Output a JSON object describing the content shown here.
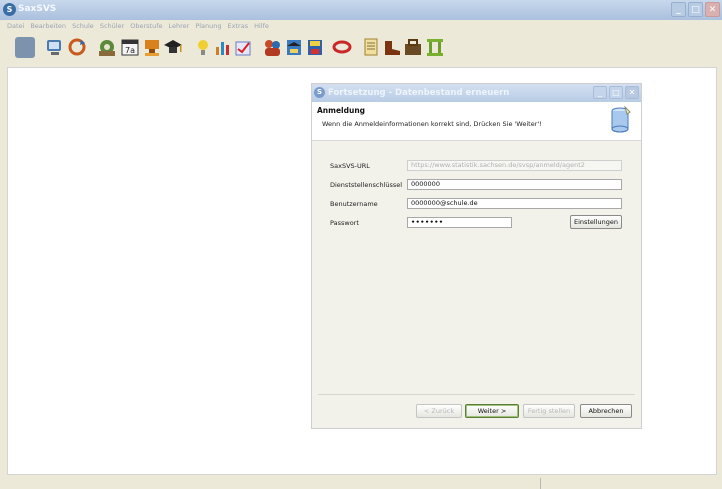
{
  "app": {
    "title": "SaxSVS",
    "icon_letter": "S"
  },
  "window_buttons": {
    "minimize": "_",
    "maximize": "□",
    "close": "✕"
  },
  "menu": [
    "Datei",
    "Bearbeiten",
    "Schule",
    "Schüler",
    "Oberstufe",
    "Lehrer",
    "Planung",
    "Extras",
    "Hilfe"
  ],
  "toolbar": {
    "icons": [
      "blank-icon",
      "computer-icon",
      "refresh-icon",
      "gear-icon",
      "calendar-icon",
      "stamp-icon",
      "graduation-cap-icon",
      "lightbulb-icon",
      "chart-icon",
      "check-chart-icon",
      "students-icon",
      "graduates-icon",
      "disk-icon",
      "ring-icon",
      "notes-icon",
      "boots-icon",
      "briefcase-icon",
      "column-icon"
    ],
    "colors": {
      "blank": "#6f8fb0",
      "computer": "#3f6da0",
      "refresh": "#c85a1e",
      "gear": "#4a7a32",
      "calendar": "#3a3a3a",
      "stamp": "#d0801a",
      "graduation": "#242424",
      "lightbulb": "#e8c020",
      "chart": "#d08020",
      "check": "#5a6ac8",
      "students": "#b23a22",
      "graduates": "#2f6ab0",
      "disk": "#c83030",
      "ring": "#c82828",
      "notes": "#e8c458",
      "boots": "#8a3a12",
      "briefcase": "#7a5a2a",
      "column": "#6aa02a"
    }
  },
  "dialog": {
    "title": "Fortsetzung - Datenbestand erneuern",
    "header_title": "Anmeldung",
    "header_subtitle": "Wenn die Anmeldeinformationen korrekt sind, Drücken Sie 'Weiter'!",
    "fields": {
      "url_label": "SaxSVS-URL",
      "url_value": "https://www.statistik.sachsen.de/svsp/anmeld/agent2",
      "key_label": "Dienststellenschlüssel",
      "key_value": "0000000",
      "user_label": "Benutzername",
      "user_value": "0000000@schule.de",
      "pass_label": "Passwort",
      "pass_value": "•••••••"
    },
    "settings_button": "Einstellungen",
    "buttons": {
      "back": "< Zurück",
      "next": "Weiter >",
      "finish": "Fertig stellen",
      "cancel": "Abbrechen"
    }
  }
}
